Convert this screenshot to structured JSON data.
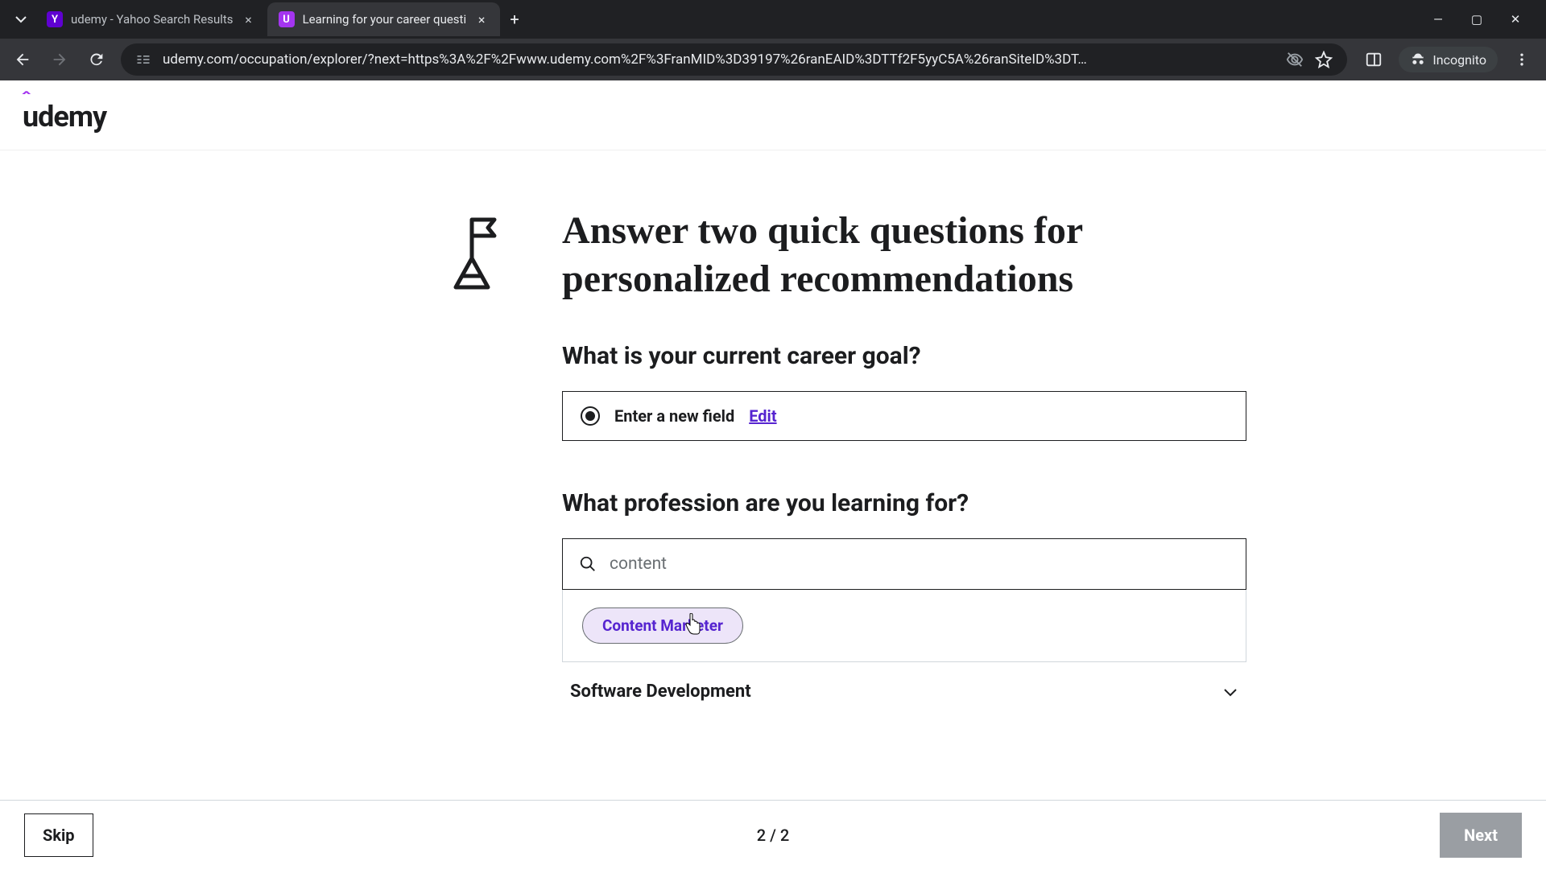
{
  "browser": {
    "tabs": [
      {
        "title": "udemy - Yahoo Search Results",
        "favicon": "Y"
      },
      {
        "title": "Learning for your career questi",
        "favicon": "U"
      }
    ],
    "url": "udemy.com/occupation/explorer/?next=https%3A%2F%2Fwww.udemy.com%2F%3FranMID%3D39197%26ranEAID%3DTTf2F5yyC5A%26ranSiteID%3DT…",
    "incognito_label": "Incognito"
  },
  "page": {
    "logo": "udemy",
    "hero_title": "Answer two quick questions for personalized recommendations",
    "q1": {
      "label": "What is your current career goal?",
      "selected": "Enter a new field",
      "edit": "Edit"
    },
    "q2": {
      "label": "What profession are you learning for?",
      "search_value": "content",
      "suggestion": "Content Marketer"
    },
    "category": "Software Development",
    "footer": {
      "skip": "Skip",
      "pager": "2 / 2",
      "next": "Next"
    }
  }
}
